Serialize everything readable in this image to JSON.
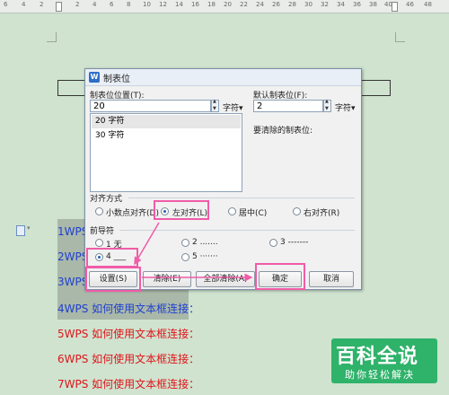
{
  "ruler": {
    "numbers": [
      "6",
      "4",
      "2",
      "",
      "2",
      "4",
      "6",
      "8",
      "10",
      "12",
      "14",
      "16",
      "18",
      "20",
      "22",
      "24",
      "26",
      "28",
      "30",
      "32",
      "34",
      "36",
      "38",
      "40",
      "42",
      "46",
      "48"
    ]
  },
  "document": {
    "lines": [
      {
        "text": "1WPS",
        "color": "#1f3fd0"
      },
      {
        "text": "2WPS",
        "color": "#1f3fd0"
      },
      {
        "text": "3WPS",
        "color": "#1f3fd0"
      },
      {
        "text": "4WPS 如何使用文本框连接：",
        "color": "#1f3fd0"
      },
      {
        "text": "5WPS 如何使用文本框连接：",
        "color": "#e0141a"
      },
      {
        "text": "6WPS 如何使用文本框连接：",
        "color": "#e0141a"
      },
      {
        "text": "7WPS 如何使用文本框连接：",
        "color": "#e0141a"
      }
    ]
  },
  "dialog": {
    "title": "制表位",
    "icon": "W",
    "tab_position_label": "制表位位置(T):",
    "tab_position_value": "20",
    "tab_position_unit": "字符▾",
    "default_tab_label": "默认制表位(F):",
    "default_tab_value": "2",
    "default_tab_unit": "字符▾",
    "clear_tabs_label": "要清除的制表位:",
    "tab_list": [
      "20 字符",
      "30 字符"
    ],
    "alignment_label": "对齐方式",
    "alignment_options": [
      "小数点对齐(D)",
      "左对齐(L)",
      "居中(C)",
      "右对齐(R)"
    ],
    "alignment_selected": "左对齐(L)",
    "leader_label": "前导符",
    "leader_options": [
      "1 无",
      "2 .......",
      "3 -------",
      "4 ___",
      "5 ·······"
    ],
    "leader_selected": "4 ___",
    "buttons": {
      "set": "设置(S)",
      "clear": "清除(E)",
      "clear_all": "全部清除(A)",
      "ok": "确定",
      "cancel": "取消"
    }
  },
  "watermark": {
    "big": "百科全说",
    "small": "助你轻松解决"
  },
  "colors": {
    "page_bg": "#cfe3cf",
    "highlight": "#f05ca8",
    "doc_blue": "#1f3fd0",
    "doc_red": "#e0141a",
    "watermark_green": "#2fb26a"
  }
}
